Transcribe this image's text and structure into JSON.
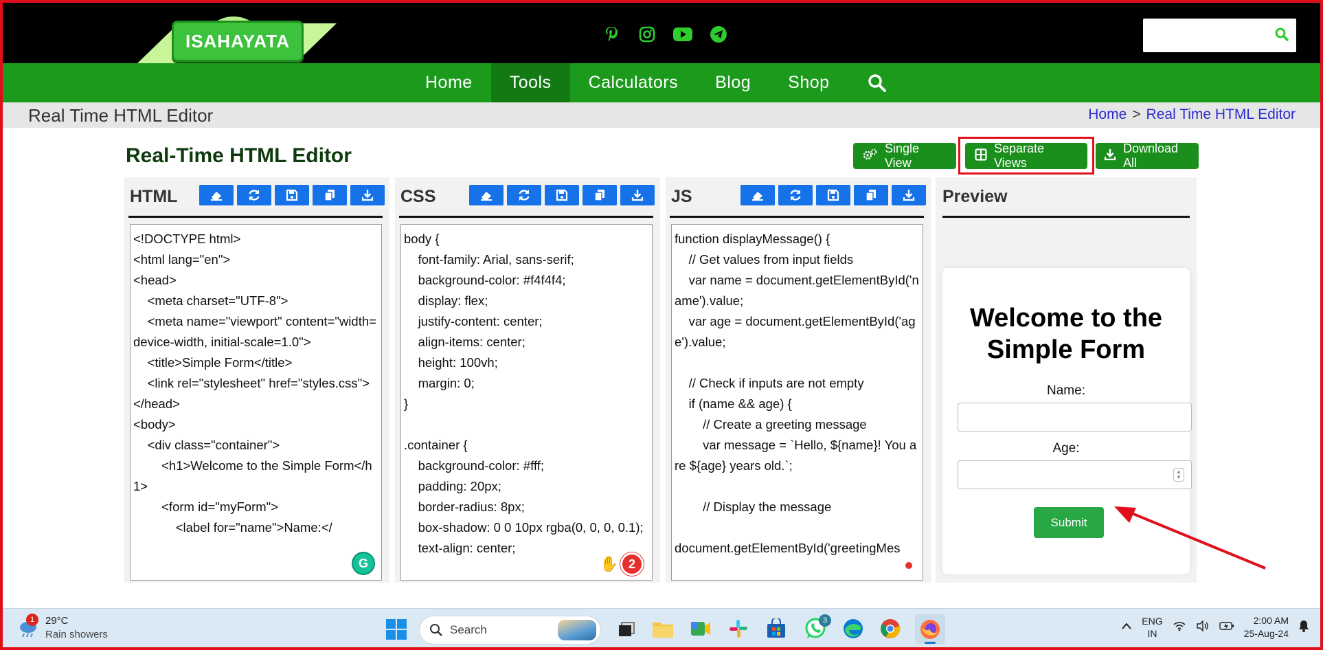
{
  "header": {
    "logo_text": "ISAHAYATA",
    "search_placeholder": ""
  },
  "nav": {
    "items": [
      "Home",
      "Tools",
      "Calculators",
      "Blog",
      "Shop"
    ],
    "active": "Tools"
  },
  "breadcrumb_bar": {
    "page_title": "Real Time HTML Editor",
    "crumbs": [
      "Home",
      "Real Time HTML Editor"
    ],
    "separator": ">"
  },
  "editor": {
    "title": "Real-Time HTML Editor",
    "buttons": {
      "single_view": "Single View",
      "separate_views": "Separate Views",
      "download_all": "Download All"
    },
    "panels": {
      "html": {
        "label": "HTML",
        "code": "<!DOCTYPE html>\n<html lang=\"en\">\n<head>\n    <meta charset=\"UTF-8\">\n    <meta name=\"viewport\" content=\"width=device-width, initial-scale=1.0\">\n    <title>Simple Form</title>\n    <link rel=\"stylesheet\" href=\"styles.css\">\n</head>\n<body>\n    <div class=\"container\">\n        <h1>Welcome to the Simple Form</h1>\n        <form id=\"myForm\">\n            <label for=\"name\">Name:</"
      },
      "css": {
        "label": "CSS",
        "code": "body {\n    font-family: Arial, sans-serif;\n    background-color: #f4f4f4;\n    display: flex;\n    justify-content: center;\n    align-items: center;\n    height: 100vh;\n    margin: 0;\n}\n\n.container {\n    background-color: #fff;\n    padding: 20px;\n    border-radius: 8px;\n    box-shadow: 0 0 10px rgba(0, 0, 0, 0.1);\n    text-align: center;",
        "badge_count": "2"
      },
      "js": {
        "label": "JS",
        "code": "function displayMessage() {\n    // Get values from input fields\n    var name = document.getElementById('name').value;\n    var age = document.getElementById('age').value;\n\n    // Check if inputs are not empty\n    if (name && age) {\n        // Create a greeting message\n        var message = `Hello, ${name}! You are ${age} years old.`;\n\n        // Display the message\n\ndocument.getElementById('greetingMes"
      },
      "preview": {
        "label": "Preview",
        "form_title": "Welcome to the Simple Form",
        "name_label": "Name:",
        "age_label": "Age:",
        "submit_label": "Submit"
      }
    }
  },
  "taskbar": {
    "weather_temp": "29°C",
    "weather_desc": "Rain showers",
    "weather_badge": "1",
    "search_label": "Search",
    "whatsapp_badge": "3",
    "lang_line1": "ENG",
    "lang_line2": "IN",
    "time": "2:00 AM",
    "date": "25-Aug-24"
  },
  "colors": {
    "brand_green": "#1b9a1b",
    "button_blue": "#1572e8",
    "highlight_red": "#e0101a",
    "submit_green": "#28a745"
  }
}
